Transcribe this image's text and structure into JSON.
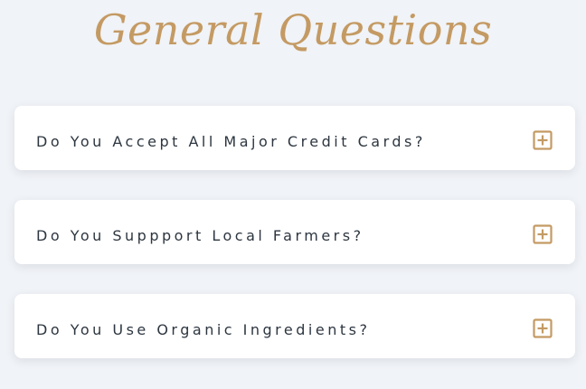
{
  "heading": "General Questions",
  "colors": {
    "accent": "#c49a63",
    "background": "#f0f3f7",
    "card": "#ffffff",
    "question_text": "#2d3640"
  },
  "faq": [
    {
      "question": "Do You Accept All Major Credit Cards?",
      "icon": "plus-square-icon",
      "expanded": false
    },
    {
      "question": "Do You Suppport Local Farmers?",
      "icon": "plus-square-icon",
      "expanded": false
    },
    {
      "question": "Do You Use Organic Ingredients?",
      "icon": "plus-square-icon",
      "expanded": false
    }
  ]
}
